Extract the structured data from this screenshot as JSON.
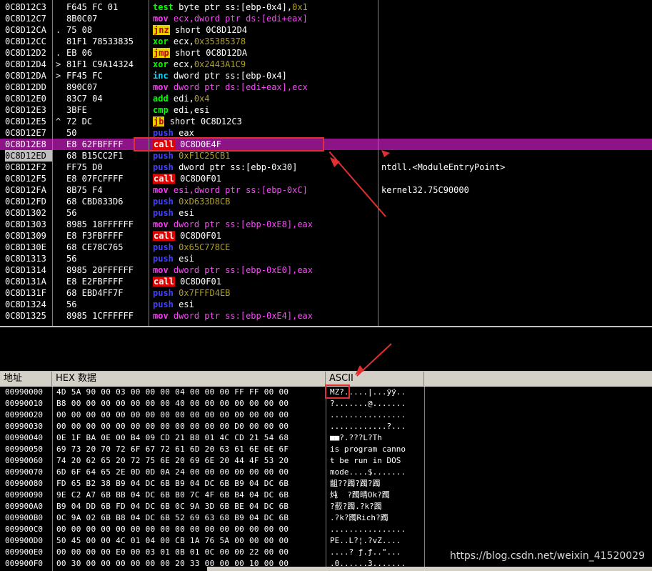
{
  "disasm": {
    "rows": [
      {
        "addr": "0C8D12C3",
        "arrow": "",
        "hex": "F645 FC 01",
        "mn": "test",
        "cls": "green",
        "ops": [
          [
            "op",
            "byte ptr ss:[ebp-0x4],"
          ],
          [
            "imm",
            "0x1"
          ]
        ],
        "cmt": ""
      },
      {
        "addr": "0C8D12C7",
        "arrow": "",
        "hex": "8B0C07",
        "mn": "mov",
        "cls": "magenta",
        "ops": [
          [
            "opr",
            "ecx,dword ptr ds:[edi+eax]"
          ]
        ],
        "cmt": ""
      },
      {
        "addr": "0C8D12CA",
        "arrow": ".",
        "hex": "75 08",
        "mn": "jnz",
        "cls": "jmpbox",
        "ops": [
          [
            "op",
            "short 0C8D12D4"
          ]
        ],
        "cmt": ""
      },
      {
        "addr": "0C8D12CC",
        "arrow": "",
        "hex": "81F1 78533835",
        "mn": "xor",
        "cls": "green",
        "ops": [
          [
            "op",
            "ecx,"
          ],
          [
            "imm",
            "0x35385378"
          ]
        ],
        "cmt": ""
      },
      {
        "addr": "0C8D12D2",
        "arrow": ".",
        "hex": "EB 06",
        "mn": "jmp",
        "cls": "jmpbox",
        "ops": [
          [
            "op",
            "short 0C8D12DA"
          ]
        ],
        "cmt": ""
      },
      {
        "addr": "0C8D12D4",
        "arrow": ">",
        "hex": "81F1 C9A14324",
        "mn": "xor",
        "cls": "green",
        "ops": [
          [
            "op",
            "ecx,"
          ],
          [
            "imm",
            "0x2443A1C9"
          ]
        ],
        "cmt": ""
      },
      {
        "addr": "0C8D12DA",
        "arrow": ">",
        "hex": "FF45 FC",
        "mn": "inc",
        "cls": "cyan",
        "ops": [
          [
            "op",
            "dword ptr ss:[ebp-0x4]"
          ]
        ],
        "cmt": ""
      },
      {
        "addr": "0C8D12DD",
        "arrow": "",
        "hex": "890C07",
        "mn": "mov",
        "cls": "magenta",
        "ops": [
          [
            "opr",
            "dword ptr ds:[edi+eax],ecx"
          ]
        ],
        "cmt": ""
      },
      {
        "addr": "0C8D12E0",
        "arrow": "",
        "hex": "83C7 04",
        "mn": "add",
        "cls": "green",
        "ops": [
          [
            "op",
            "edi,"
          ],
          [
            "imm",
            "0x4"
          ]
        ],
        "cmt": ""
      },
      {
        "addr": "0C8D12E3",
        "arrow": "",
        "hex": "3BFE",
        "mn": "cmp",
        "cls": "green",
        "ops": [
          [
            "op",
            "edi,esi"
          ]
        ],
        "cmt": ""
      },
      {
        "addr": "0C8D12E5",
        "arrow": "^",
        "hex": "72 DC",
        "mn": "jb",
        "cls": "jmpbox",
        "ops": [
          [
            "op",
            "short 0C8D12C3"
          ]
        ],
        "cmt": ""
      },
      {
        "addr": "0C8D12E7",
        "arrow": "",
        "hex": "50",
        "mn": "push",
        "cls": "blue",
        "ops": [
          [
            "op",
            "eax"
          ]
        ],
        "cmt": ""
      },
      {
        "addr": "0C8D12E8",
        "arrow": "",
        "hex": "E8 62FBFFFF",
        "mn": "call",
        "cls": "callbox",
        "ops": [
          [
            "op",
            "0C8D0E4F"
          ]
        ],
        "cmt": "",
        "sel": true
      },
      {
        "addr": "0C8D12ED",
        "arrow": "",
        "hex": "68 B15CC2F1",
        "mn": "push",
        "cls": "blue",
        "ops": [
          [
            "imm",
            "0xF1C25CB1"
          ]
        ],
        "cmt": "",
        "cur": true
      },
      {
        "addr": "0C8D12F2",
        "arrow": "",
        "hex": "FF75 D0",
        "mn": "push",
        "cls": "blue",
        "ops": [
          [
            "op",
            "dword ptr ss:[ebp-0x30]"
          ]
        ],
        "cmt": "ntdll.<ModuleEntryPoint>"
      },
      {
        "addr": "0C8D12F5",
        "arrow": "",
        "hex": "E8 07FCFFFF",
        "mn": "call",
        "cls": "callbox",
        "ops": [
          [
            "op",
            "0C8D0F01"
          ]
        ],
        "cmt": ""
      },
      {
        "addr": "0C8D12FA",
        "arrow": "",
        "hex": "8B75 F4",
        "mn": "mov",
        "cls": "magenta",
        "ops": [
          [
            "opr",
            "esi,dword ptr ss:[ebp-0xC]"
          ]
        ],
        "cmt": "kernel32.75C90000"
      },
      {
        "addr": "0C8D12FD",
        "arrow": "",
        "hex": "68 CBD833D6",
        "mn": "push",
        "cls": "blue",
        "ops": [
          [
            "imm",
            "0xD633D8CB"
          ]
        ],
        "cmt": ""
      },
      {
        "addr": "0C8D1302",
        "arrow": "",
        "hex": "56",
        "mn": "push",
        "cls": "blue",
        "ops": [
          [
            "op",
            "esi"
          ]
        ],
        "cmt": ""
      },
      {
        "addr": "0C8D1303",
        "arrow": "",
        "hex": "8985 18FFFFFF",
        "mn": "mov",
        "cls": "magenta",
        "ops": [
          [
            "opr",
            "dword ptr ss:[ebp-0xE8],eax"
          ]
        ],
        "cmt": ""
      },
      {
        "addr": "0C8D1309",
        "arrow": "",
        "hex": "E8 F3FBFFFF",
        "mn": "call",
        "cls": "callbox",
        "ops": [
          [
            "op",
            "0C8D0F01"
          ]
        ],
        "cmt": ""
      },
      {
        "addr": "0C8D130E",
        "arrow": "",
        "hex": "68 CE78C765",
        "mn": "push",
        "cls": "blue",
        "ops": [
          [
            "imm",
            "0x65C778CE"
          ]
        ],
        "cmt": ""
      },
      {
        "addr": "0C8D1313",
        "arrow": "",
        "hex": "56",
        "mn": "push",
        "cls": "blue",
        "ops": [
          [
            "op",
            "esi"
          ]
        ],
        "cmt": ""
      },
      {
        "addr": "0C8D1314",
        "arrow": "",
        "hex": "8985 20FFFFFF",
        "mn": "mov",
        "cls": "magenta",
        "ops": [
          [
            "opr",
            "dword ptr ss:[ebp-0xE0],eax"
          ]
        ],
        "cmt": ""
      },
      {
        "addr": "0C8D131A",
        "arrow": "",
        "hex": "E8 E2FBFFFF",
        "mn": "call",
        "cls": "callbox",
        "ops": [
          [
            "op",
            "0C8D0F01"
          ]
        ],
        "cmt": ""
      },
      {
        "addr": "0C8D131F",
        "arrow": "",
        "hex": "68 EBD4FF7F",
        "mn": "push",
        "cls": "blue",
        "ops": [
          [
            "imm",
            "0x7FFFD4EB"
          ]
        ],
        "cmt": ""
      },
      {
        "addr": "0C8D1324",
        "arrow": "",
        "hex": "56",
        "mn": "push",
        "cls": "blue",
        "ops": [
          [
            "op",
            "esi"
          ]
        ],
        "cmt": ""
      },
      {
        "addr": "0C8D1325",
        "arrow": "",
        "hex": "8985 1CFFFFFF",
        "mn": "mov",
        "cls": "magenta",
        "ops": [
          [
            "opr",
            "dword ptr ss:[ebp-0xE4],eax"
          ]
        ],
        "cmt": ""
      }
    ]
  },
  "dump": {
    "header": {
      "addr": "地址",
      "hex": "HEX 数据",
      "ascii": "ASCII"
    },
    "rows": [
      {
        "addr": "00990000",
        "bytes": "4D 5A 90 00 03 00 00 00 04 00 00 00 FF FF 00 00",
        "ascii": "MZ?.....|...ÿÿ.."
      },
      {
        "addr": "00990010",
        "bytes": "B8 00 00 00 00 00 00 00 40 00 00 00 00 00 00 00",
        "ascii": "?.......@......."
      },
      {
        "addr": "00990020",
        "bytes": "00 00 00 00 00 00 00 00 00 00 00 00 00 00 00 00",
        "ascii": "................"
      },
      {
        "addr": "00990030",
        "bytes": "00 00 00 00 00 00 00 00 00 00 00 00 D0 00 00 00",
        "ascii": "............?..."
      },
      {
        "addr": "00990040",
        "bytes": "0E 1F BA 0E 00 B4 09 CD 21 B8 01 4C CD 21 54 68",
        "ascii": "■■?.???L?Th"
      },
      {
        "addr": "00990050",
        "bytes": "69 73 20 70 72 6F 67 72 61 6D 20 63 61 6E 6E 6F",
        "ascii": "is program canno"
      },
      {
        "addr": "00990060",
        "bytes": "74 20 62 65 20 72 75 6E 20 69 6E 20 44 4F 53 20",
        "ascii": "t be run in DOS "
      },
      {
        "addr": "00990070",
        "bytes": "6D 6F 64 65 2E 0D 0D 0A 24 00 00 00 00 00 00 00",
        "ascii": "mode....$......."
      },
      {
        "addr": "00990080",
        "bytes": "FD 65 B2 38 B9 04 DC 6B B9 04 DC 6B B9 04 DC 6B",
        "ascii": "齟??躅?躅?躅"
      },
      {
        "addr": "00990090",
        "bytes": "9E C2 A7 6B BB 04 DC 6B B0 7C 4F 6B B4 04 DC 6B",
        "ascii": "炖  ?躅晴Ok?躅"
      },
      {
        "addr": "009900A0",
        "bytes": "B9 04 DD 6B FD 04 DC 6B 0C 9A 3D 6B BE 04 DC 6B",
        "ascii": "?蘝?躅.?k?躅"
      },
      {
        "addr": "009900B0",
        "bytes": "0C 9A 02 6B B8 04 DC 6B 52 69 63 68 B9 04 DC 6B",
        "ascii": ".?k?躅Rich?躅"
      },
      {
        "addr": "009900C0",
        "bytes": "00 00 00 00 00 00 00 00 00 00 00 00 00 00 00 00",
        "ascii": "................"
      },
      {
        "addr": "009900D0",
        "bytes": "50 45 00 00 4C 01 04 00 CB 1A 76 5A 00 00 00 00",
        "ascii": "PE..L?¦.?vZ...."
      },
      {
        "addr": "009900E0",
        "bytes": "00 00 00 00 E0 00 03 01 0B 01 0C 00 00 22 00 00",
        "ascii": "....? ƒ.ƒ..\"..."
      },
      {
        "addr": "009900F0",
        "bytes": "00 30 00 00 00 00 00 00 20 33 00 00 00 10 00 00",
        "ascii": ".0......3......."
      }
    ]
  },
  "watermark": "https://blog.csdn.net/weixin_41520029",
  "colors": {
    "selection": "#8c1487",
    "annotation": "#e03030",
    "call": "#e00000",
    "jump": "#e8d000"
  }
}
